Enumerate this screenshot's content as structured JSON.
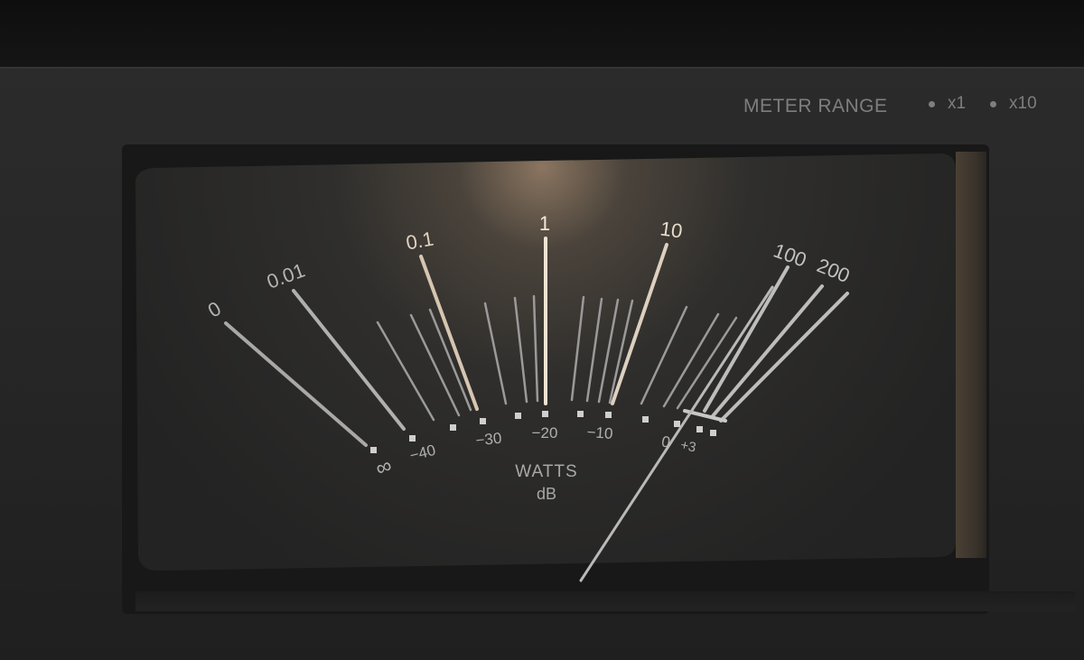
{
  "panel": {
    "range_label": "METER RANGE",
    "options": [
      {
        "label": "x1"
      },
      {
        "label": "x10"
      }
    ]
  },
  "meter": {
    "watts_scale": [
      "0",
      "0.01",
      "0.1",
      "1",
      "10",
      "100",
      "200"
    ],
    "db_scale": [
      "∞",
      "−40",
      "−30",
      "−20",
      "−10",
      "0",
      "+3"
    ],
    "unit_primary": "WATTS",
    "unit_secondary": "dB",
    "colors": {
      "face": "#262626",
      "glow": "#c9a882",
      "tick": "#cfcfcf",
      "needle": "#b8b8b8"
    }
  }
}
